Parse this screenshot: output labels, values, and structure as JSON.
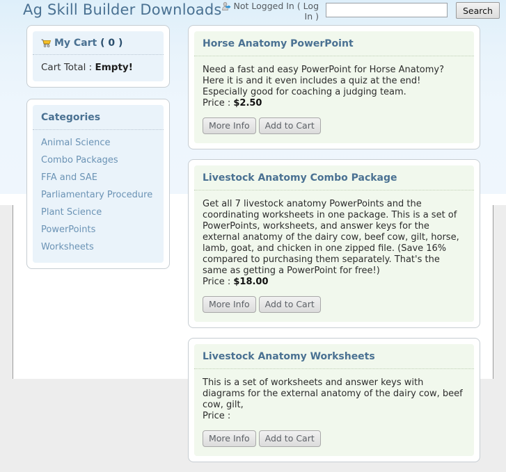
{
  "header": {
    "title": "Ag Skill Builder Downloads",
    "login_status_prefix": "Not Logged In ( ",
    "login_link": "Log In",
    "login_status_suffix": " )",
    "login_status_full": "Not Logged In ( Log In )",
    "login_icon": "user-login-icon",
    "search_value": "",
    "search_placeholder": "",
    "search_button": "Search"
  },
  "colors": {
    "title": "#4a7192",
    "link": "#6b93b5",
    "panel_blue": "#eaf3fa",
    "panel_green": "#f1f8ed",
    "page_top": "#deeffa",
    "page_bottom": "#ededed"
  },
  "sidebar": {
    "cart": {
      "icon": "shopping-cart-icon",
      "label": "My Cart",
      "count": "( 0 )",
      "total_label": "Cart Total : ",
      "total_value": "Empty!"
    },
    "categories": {
      "header": "Categories",
      "items": [
        {
          "label": "Animal Science"
        },
        {
          "label": "Combo Packages"
        },
        {
          "label": "FFA and SAE"
        },
        {
          "label": "Parliamentary Procedure"
        },
        {
          "label": "Plant Science"
        },
        {
          "label": "PowerPoints"
        },
        {
          "label": "Worksheets"
        }
      ]
    }
  },
  "main": {
    "products": [
      {
        "title": "Horse Anatomy PowerPoint",
        "description": "Need a fast and easy PowerPoint for Horse Anatomy? Here it is and it even includes a quiz at the end! Especially good for coaching a judging team.",
        "price_label": "Price : ",
        "price": "$2.50",
        "more_info": "More Info",
        "add_to_cart": "Add to Cart"
      },
      {
        "title": "Livestock Anatomy Combo Package",
        "description": "Get all 7 livestock anatomy PowerPoints and the coordinating worksheets in one package. This is a set of PowerPoints, worksheets, and answer keys for the external anatomy of the dairy cow, beef cow, gilt, horse, lamb, goat, and chicken in one zipped file. (Save 16% compared to purchasing them separately. That's the same as getting a PowerPoint for free!)",
        "price_label": "Price : ",
        "price": "$18.00",
        "more_info": "More Info",
        "add_to_cart": "Add to Cart"
      },
      {
        "title": "Livestock Anatomy Worksheets",
        "description": "This is a set of worksheets and answer keys with diagrams for the external anatomy of the dairy cow, beef cow, gilt,",
        "price_label": "Price : ",
        "price": "",
        "more_info": "More Info",
        "add_to_cart": "Add to Cart"
      }
    ]
  }
}
